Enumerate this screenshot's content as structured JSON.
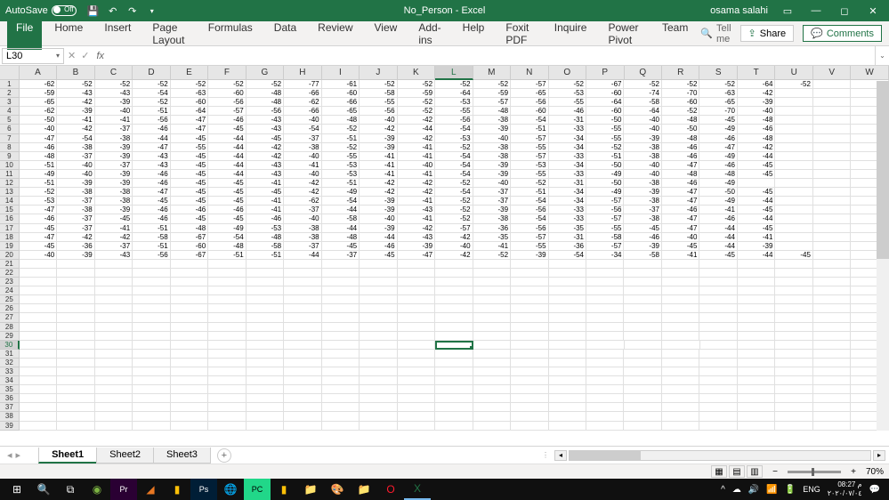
{
  "titlebar": {
    "autosave": "AutoSave",
    "autosave_state": "Off",
    "filename": "No_Person - Excel",
    "username": "osama salahi"
  },
  "ribbon": {
    "tabs": [
      "File",
      "Home",
      "Insert",
      "Page Layout",
      "Formulas",
      "Data",
      "Review",
      "View",
      "Add-ins",
      "Help",
      "Foxit PDF",
      "Inquire",
      "Power Pivot",
      "Team"
    ],
    "tellme": "Tell me",
    "share": "Share",
    "comments": "Comments"
  },
  "formulabar": {
    "namebox": "L30",
    "fx": "fx"
  },
  "columns": [
    "A",
    "B",
    "C",
    "D",
    "E",
    "F",
    "G",
    "H",
    "I",
    "J",
    "K",
    "L",
    "M",
    "N",
    "O",
    "P",
    "Q",
    "R",
    "S",
    "T",
    "U",
    "V",
    "W"
  ],
  "active_col": "L",
  "active_row": 30,
  "data": [
    [
      -62,
      -52,
      -52,
      -52,
      -52,
      -52,
      -52,
      -77,
      -61,
      -52,
      -52,
      -52,
      -52,
      -57,
      -52,
      -67,
      -52,
      -52,
      -52,
      -64,
      -52
    ],
    [
      -59,
      -43,
      -43,
      -54,
      -63,
      -60,
      -48,
      -66,
      -60,
      -58,
      -59,
      -64,
      -59,
      -65,
      -53,
      -60,
      -74,
      -70,
      -63,
      -42
    ],
    [
      -65,
      -42,
      -39,
      -52,
      -60,
      -56,
      -48,
      -62,
      -66,
      -55,
      -52,
      -53,
      -57,
      -56,
      -55,
      -64,
      -58,
      -60,
      -65,
      -39
    ],
    [
      -62,
      -39,
      -40,
      -51,
      -64,
      -57,
      -56,
      -66,
      -65,
      -56,
      -52,
      -55,
      -48,
      -60,
      -46,
      -60,
      -64,
      -52,
      -70,
      -40
    ],
    [
      -50,
      -41,
      -41,
      -56,
      -47,
      -46,
      -43,
      -40,
      -48,
      -40,
      -42,
      -56,
      -38,
      -54,
      -31,
      -50,
      -40,
      -48,
      -45,
      -48
    ],
    [
      -40,
      -42,
      -37,
      -46,
      -47,
      -45,
      -43,
      -54,
      -52,
      -42,
      -44,
      -54,
      -39,
      -51,
      -33,
      -55,
      -40,
      -50,
      -49,
      -46
    ],
    [
      -47,
      -54,
      -38,
      -44,
      -45,
      -44,
      -45,
      -37,
      -51,
      -39,
      -42,
      -53,
      -40,
      -57,
      -34,
      -55,
      -39,
      -48,
      -46,
      -48
    ],
    [
      -46,
      -38,
      -39,
      -47,
      -55,
      -44,
      -42,
      -38,
      -52,
      -39,
      -41,
      -52,
      -38,
      -55,
      -34,
      -52,
      -38,
      -46,
      -47,
      -42
    ],
    [
      -48,
      -37,
      -39,
      -43,
      -45,
      -44,
      -42,
      -40,
      -55,
      -41,
      -41,
      -54,
      -38,
      -57,
      -33,
      -51,
      -38,
      -46,
      -49,
      -44
    ],
    [
      -51,
      -40,
      -37,
      -43,
      -45,
      -44,
      -43,
      -41,
      -53,
      -41,
      -40,
      -54,
      -39,
      -53,
      -34,
      -50,
      -40,
      -47,
      -46,
      -45
    ],
    [
      -49,
      -40,
      -39,
      -46,
      -45,
      -44,
      -43,
      -40,
      -53,
      -41,
      -41,
      -54,
      -39,
      -55,
      -33,
      -49,
      -40,
      -48,
      -48,
      -45
    ],
    [
      -51,
      -39,
      -39,
      -46,
      -45,
      -45,
      -41,
      -42,
      -51,
      -42,
      -42,
      -52,
      -40,
      -52,
      -31,
      -50,
      -38,
      -46,
      -49
    ],
    [
      -52,
      -38,
      -38,
      -47,
      -45,
      -45,
      -45,
      -42,
      -49,
      -42,
      -42,
      -54,
      -37,
      -51,
      -34,
      -49,
      -39,
      -47,
      -50,
      -45
    ],
    [
      -53,
      -37,
      -38,
      -45,
      -45,
      -45,
      -41,
      -62,
      -54,
      -39,
      -41,
      -52,
      -37,
      -54,
      -34,
      -57,
      -38,
      -47,
      -49,
      -44
    ],
    [
      -47,
      -38,
      -39,
      -46,
      -46,
      -46,
      -41,
      -37,
      -44,
      -39,
      -43,
      -52,
      -39,
      -56,
      -33,
      -56,
      -37,
      -46,
      -41,
      -45
    ],
    [
      -46,
      -37,
      -45,
      -46,
      -45,
      -45,
      -46,
      -40,
      -58,
      -40,
      -41,
      -52,
      -38,
      -54,
      -33,
      -57,
      -38,
      -47,
      -46,
      -44
    ],
    [
      -45,
      -37,
      -41,
      -51,
      -48,
      -49,
      -53,
      -38,
      -44,
      -39,
      -42,
      -57,
      -36,
      -56,
      -35,
      -55,
      -45,
      -47,
      -44,
      -45
    ],
    [
      -47,
      -42,
      -42,
      -58,
      -67,
      -54,
      -48,
      -38,
      -48,
      -44,
      -43,
      -42,
      -35,
      -57,
      -31,
      -58,
      -46,
      -40,
      -44,
      -41
    ],
    [
      -45,
      -36,
      -37,
      -51,
      -60,
      -48,
      -58,
      -37,
      -45,
      -46,
      -39,
      -40,
      -41,
      -55,
      -36,
      -57,
      -39,
      -45,
      -44,
      -39
    ],
    [
      -40,
      -39,
      -43,
      -56,
      -67,
      -51,
      -51,
      -44,
      -37,
      -45,
      -47,
      -42,
      -52,
      -39,
      -54,
      -34,
      -58,
      -41,
      -45,
      -44,
      -45
    ]
  ],
  "row_count": 39,
  "sheets": [
    "Sheet1",
    "Sheet2",
    "Sheet3"
  ],
  "active_sheet": 0,
  "statusbar": {
    "zoom": "70%"
  },
  "taskbar": {
    "lang": "ENG",
    "time": "08:27 م",
    "date": "٢٠٢٠/٠٧/٠٤"
  }
}
